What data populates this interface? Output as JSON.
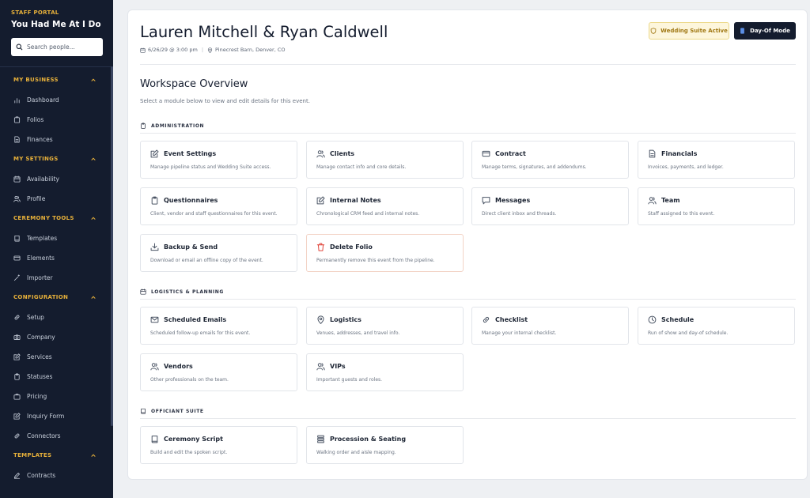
{
  "sidebar": {
    "portal_label": "STAFF PORTAL",
    "brand": "You Had Me At I Do",
    "search_placeholder": "Search people...",
    "sections": [
      {
        "label": "MY BUSINESS",
        "items": [
          {
            "label": "Dashboard",
            "icon": "bar-chart-icon"
          },
          {
            "label": "Folios",
            "icon": "folder-icon"
          },
          {
            "label": "Finances",
            "icon": "document-icon"
          }
        ]
      },
      {
        "label": "MY SETTINGS",
        "items": [
          {
            "label": "Availability",
            "icon": "calendar-icon"
          },
          {
            "label": "Profile",
            "icon": "users-icon"
          }
        ]
      },
      {
        "label": "CEREMONY TOOLS",
        "items": [
          {
            "label": "Templates",
            "icon": "book-icon"
          },
          {
            "label": "Elements",
            "icon": "card-icon"
          },
          {
            "label": "Importer",
            "icon": "wand-icon"
          }
        ]
      },
      {
        "label": "CONFIGURATION",
        "items": [
          {
            "label": "Setup",
            "icon": "link-icon"
          },
          {
            "label": "Company",
            "icon": "camera-icon"
          },
          {
            "label": "Services",
            "icon": "edit-icon"
          },
          {
            "label": "Statuses",
            "icon": "clipboard-icon"
          },
          {
            "label": "Pricing",
            "icon": "briefcase-icon"
          },
          {
            "label": "Inquiry Form",
            "icon": "edit-icon"
          },
          {
            "label": "Connectors",
            "icon": "link-icon"
          }
        ]
      },
      {
        "label": "TEMPLATES",
        "items": [
          {
            "label": "Contracts",
            "icon": "pen-icon"
          }
        ]
      }
    ]
  },
  "header": {
    "title": "Lauren Mitchell & Ryan Caldwell",
    "date": "6/26/29 @ 3:00 pm",
    "location": "Pinecrest Barn, Denver, CO",
    "badge": "Wedding Suite Active",
    "dayof_button": "Day-Of Mode"
  },
  "workspace": {
    "title": "Workspace Overview",
    "subtitle": "Select a module below to view and edit details for this event."
  },
  "sections": [
    {
      "label": "ADMINISTRATION",
      "icon": "clipboard-icon",
      "cards": [
        {
          "title": "Event Settings",
          "desc": "Manage pipeline status and Wedding Suite access.",
          "icon": "edit-icon"
        },
        {
          "title": "Clients",
          "desc": "Manage contact info and core details.",
          "icon": "users-icon"
        },
        {
          "title": "Contract",
          "desc": "Manage terms, signatures, and addendums.",
          "icon": "card-icon"
        },
        {
          "title": "Financials",
          "desc": "Invoices, payments, and ledger.",
          "icon": "document-icon"
        },
        {
          "title": "Questionnaires",
          "desc": "Client, vendor and staff questionnaires for this event.",
          "icon": "clipboard-icon"
        },
        {
          "title": "Internal Notes",
          "desc": "Chronological CRM feed and internal notes.",
          "icon": "edit-icon"
        },
        {
          "title": "Messages",
          "desc": "Direct client inbox and threads.",
          "icon": "message-icon"
        },
        {
          "title": "Team",
          "desc": "Staff assigned to this event.",
          "icon": "users-icon"
        },
        {
          "title": "Backup & Send",
          "desc": "Download or email an offline copy of the event.",
          "icon": "download-icon"
        },
        {
          "title": "Delete Folio",
          "desc": "Permanently remove this event from the pipeline.",
          "icon": "trash-icon"
        }
      ]
    },
    {
      "label": "LOGISTICS & PLANNING",
      "icon": "calendar-icon",
      "cards": [
        {
          "title": "Scheduled Emails",
          "desc": "Scheduled follow-up emails for this event.",
          "icon": "mail-icon"
        },
        {
          "title": "Logistics",
          "desc": "Venues, addresses, and travel info.",
          "icon": "map-pin-icon"
        },
        {
          "title": "Checklist",
          "desc": "Manage your internal checklist.",
          "icon": "link-icon"
        },
        {
          "title": "Schedule",
          "desc": "Run of show and day-of schedule.",
          "icon": "clock-icon"
        },
        {
          "title": "Vendors",
          "desc": "Other professionals on the team.",
          "icon": "users-icon"
        },
        {
          "title": "VIPs",
          "desc": "Important guests and roles.",
          "icon": "users-icon"
        }
      ]
    },
    {
      "label": "OFFICIANT SUITE",
      "icon": "book-icon",
      "cards": [
        {
          "title": "Ceremony Script",
          "desc": "Build and edit the spoken script.",
          "icon": "book-icon"
        },
        {
          "title": "Procession & Seating",
          "desc": "Walking order and aisle mapping.",
          "icon": "seating-icon"
        }
      ]
    }
  ],
  "colors": {
    "sidebar_bg": "#141c2e",
    "accent_gold": "#e8b13a",
    "danger": "#e0443a",
    "badge_bg": "#fdf6dc",
    "badge_text": "#a07712"
  }
}
